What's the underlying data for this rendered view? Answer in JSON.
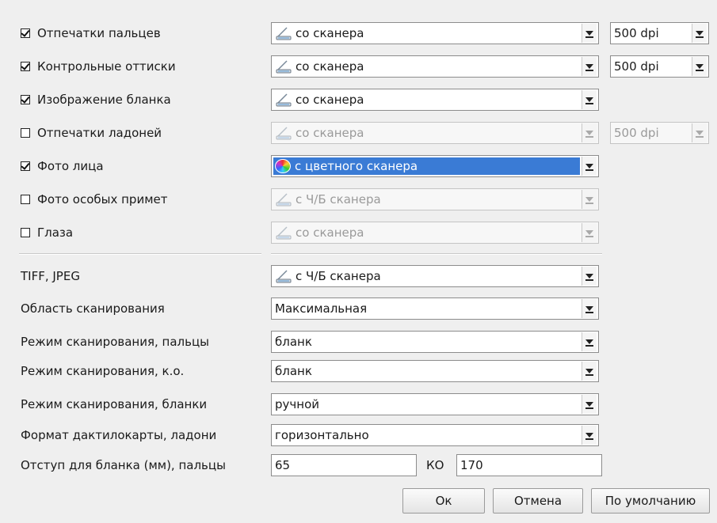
{
  "images": {
    "fingerprints": {
      "label": "Отпечатки пальцев",
      "checked": true,
      "source": "со сканера",
      "dpi": "500 dpi",
      "enabled": true
    },
    "control": {
      "label": "Контрольные оттиски",
      "checked": true,
      "source": "со сканера",
      "dpi": "500 dpi",
      "enabled": true
    },
    "blank": {
      "label": "Изображение бланка",
      "checked": true,
      "source": "со сканера",
      "enabled": true
    },
    "palms": {
      "label": "Отпечатки ладоней",
      "checked": false,
      "source": "со сканера",
      "dpi": "500 dpi",
      "enabled": false
    },
    "face": {
      "label": "Фото лица",
      "checked": true,
      "source": "с цветного сканера",
      "enabled": true,
      "focused": true
    },
    "marks": {
      "label": "Фото особых примет",
      "checked": false,
      "source": "с Ч/Б сканера",
      "enabled": false
    },
    "eyes": {
      "label": "Глаза",
      "checked": false,
      "source": "со сканера",
      "enabled": false
    }
  },
  "settings": {
    "tiff": {
      "label": "TIFF, JPEG",
      "value": "с Ч/Б сканера"
    },
    "area": {
      "label": "Область сканирования",
      "value": "Максимальная"
    },
    "mode_fingers": {
      "label": "Режим сканирования, пальцы",
      "value": "бланк"
    },
    "mode_ko": {
      "label": "Режим сканирования, к.о.",
      "value": "бланк"
    },
    "mode_blanks": {
      "label": "Режим сканирования, бланки",
      "value": "ручной"
    },
    "card_format": {
      "label": "Формат дактилокарты, ладони",
      "value": "горизонтально"
    },
    "offset": {
      "label": "Отступ для бланка (мм), пальцы",
      "value": "65",
      "ko_label": "КО",
      "ko_value": "170"
    }
  },
  "buttons": {
    "ok": "Ок",
    "cancel": "Отмена",
    "defaults": "По умолчанию"
  },
  "colors": {
    "selection": "#3a7bd5",
    "background": "#efefef"
  }
}
